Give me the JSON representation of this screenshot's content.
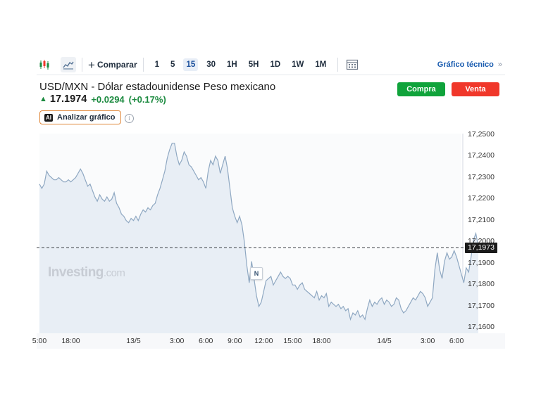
{
  "toolbar": {
    "compare_label": "Comparar",
    "intervals": [
      "1",
      "5",
      "15",
      "30",
      "1H",
      "5H",
      "1D",
      "1W",
      "1M"
    ],
    "active_interval": "15",
    "technical_chart_label": "Gráfico técnico",
    "chevron": "»"
  },
  "instrument": {
    "title": "USD/MXN - Dólar estadounidense Peso mexicano",
    "price": "17.1974",
    "change": "+0.0294",
    "change_pct": "(+0.17%)",
    "trend_arrow": "▲"
  },
  "actions": {
    "buy_label": "Compra",
    "sell_label": "Venta",
    "ai_badge": "AI",
    "ai_label": "Analizar gráfico",
    "info_glyph": "i"
  },
  "colors": {
    "positive": "#1b8a3f",
    "buy": "#10a33b",
    "sell": "#f0372a",
    "line": "#8fa8c2",
    "area": "#e8eef5"
  },
  "chart": {
    "watermark": "Investing",
    "watermark_suffix": ".com",
    "news_marker": "N",
    "current_price_label": "17,1973"
  },
  "chart_data": {
    "type": "area",
    "y_ticks": [
      "17,2500",
      "17,2400",
      "17,2300",
      "17,2200",
      "17,2100",
      "17,2000",
      "17,1900",
      "17,1800",
      "17,1700",
      "17,1600"
    ],
    "ylim": [
      17.1575,
      17.2505
    ],
    "x_tick_labels": [
      {
        "label": "5:00",
        "idx": 0
      },
      {
        "label": "18:00",
        "idx": 13
      },
      {
        "label": "13/5",
        "idx": 39
      },
      {
        "label": "3:00",
        "idx": 57
      },
      {
        "label": "6:00",
        "idx": 69
      },
      {
        "label": "9:00",
        "idx": 81
      },
      {
        "label": "12:00",
        "idx": 93
      },
      {
        "label": "15:00",
        "idx": 105
      },
      {
        "label": "18:00",
        "idx": 117
      },
      {
        "label": "14/5",
        "idx": 143
      },
      {
        "label": "3:00",
        "idx": 161
      },
      {
        "label": "6:00",
        "idx": 173
      }
    ],
    "x_count": 176,
    "reference_line": 17.1973,
    "values": [
      17.227,
      17.225,
      17.227,
      17.233,
      17.231,
      17.23,
      17.229,
      17.229,
      17.23,
      17.229,
      17.228,
      17.228,
      17.229,
      17.228,
      17.229,
      17.23,
      17.232,
      17.234,
      17.232,
      17.229,
      17.226,
      17.227,
      17.224,
      17.221,
      17.219,
      17.222,
      17.22,
      17.219,
      17.221,
      17.219,
      17.22,
      17.223,
      17.218,
      17.216,
      17.213,
      17.212,
      17.21,
      17.209,
      17.211,
      17.21,
      17.212,
      17.21,
      17.213,
      17.215,
      17.214,
      17.216,
      17.215,
      17.217,
      17.218,
      17.222,
      17.225,
      17.229,
      17.233,
      17.239,
      17.243,
      17.246,
      17.246,
      17.24,
      17.236,
      17.238,
      17.242,
      17.24,
      17.236,
      17.235,
      17.233,
      17.231,
      17.229,
      17.23,
      17.228,
      17.225,
      17.233,
      17.238,
      17.236,
      17.24,
      17.238,
      17.232,
      17.236,
      17.24,
      17.234,
      17.225,
      17.216,
      17.212,
      17.209,
      17.212,
      17.208,
      17.2,
      17.189,
      17.181,
      17.191,
      17.183,
      17.175,
      17.17,
      17.172,
      17.177,
      17.182,
      17.183,
      17.184,
      17.18,
      17.182,
      17.184,
      17.186,
      17.184,
      17.183,
      17.184,
      17.183,
      17.18,
      17.18,
      17.178,
      17.18,
      17.181,
      17.178,
      17.177,
      17.176,
      17.175,
      17.174,
      17.177,
      17.173,
      17.175,
      17.174,
      17.176,
      17.17,
      17.172,
      17.171,
      17.17,
      17.171,
      17.169,
      17.17,
      17.168,
      17.169,
      17.164,
      17.167,
      17.166,
      17.168,
      17.165,
      17.166,
      17.164,
      17.169,
      17.173,
      17.17,
      17.172,
      17.171,
      17.173,
      17.174,
      17.171,
      17.173,
      17.172,
      17.17,
      17.171,
      17.174,
      17.173,
      17.169,
      17.167,
      17.168,
      17.17,
      17.172,
      17.174,
      17.173,
      17.175,
      17.177,
      17.176,
      17.174,
      17.17,
      17.172,
      17.174,
      17.187,
      17.195,
      17.187,
      17.183,
      17.191,
      17.195,
      17.192,
      17.193,
      17.196,
      17.193,
      17.189,
      17.185,
      17.181,
      17.188,
      17.186,
      17.193,
      17.201,
      17.204,
      17.198
    ]
  }
}
